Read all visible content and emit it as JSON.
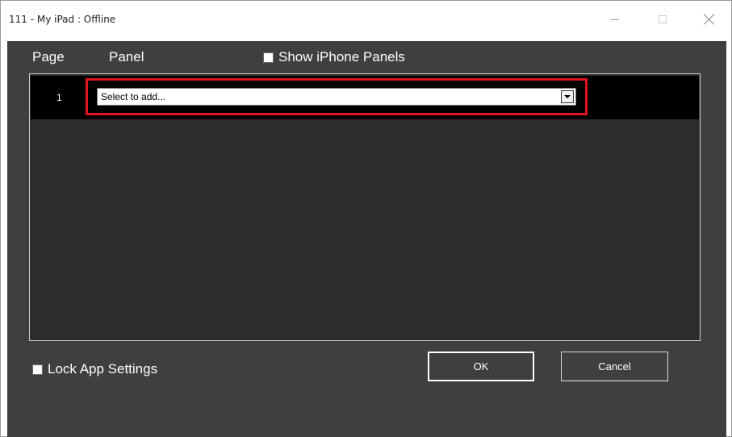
{
  "window": {
    "title": "111 - My iPad : Offline",
    "controls": {
      "minimize": "minimize-icon",
      "maximize": "maximize-icon",
      "close": "close-icon"
    }
  },
  "header": {
    "page_label": "Page",
    "panel_label": "Panel",
    "show_iphone_panels": {
      "label": "Show iPhone Panels",
      "checked": false
    }
  },
  "grid": {
    "rows": [
      {
        "page": "1",
        "panel_select": {
          "value": "Select to add...",
          "highlighted": true
        }
      }
    ]
  },
  "footer": {
    "lock_app_settings": {
      "label": "Lock App Settings",
      "checked": false
    },
    "ok_label": "OK",
    "cancel_label": "Cancel"
  },
  "colors": {
    "background": "#3f3f3f",
    "grid_background": "#2d2d2d",
    "row_background": "#000000",
    "highlight": "#e0141e"
  }
}
